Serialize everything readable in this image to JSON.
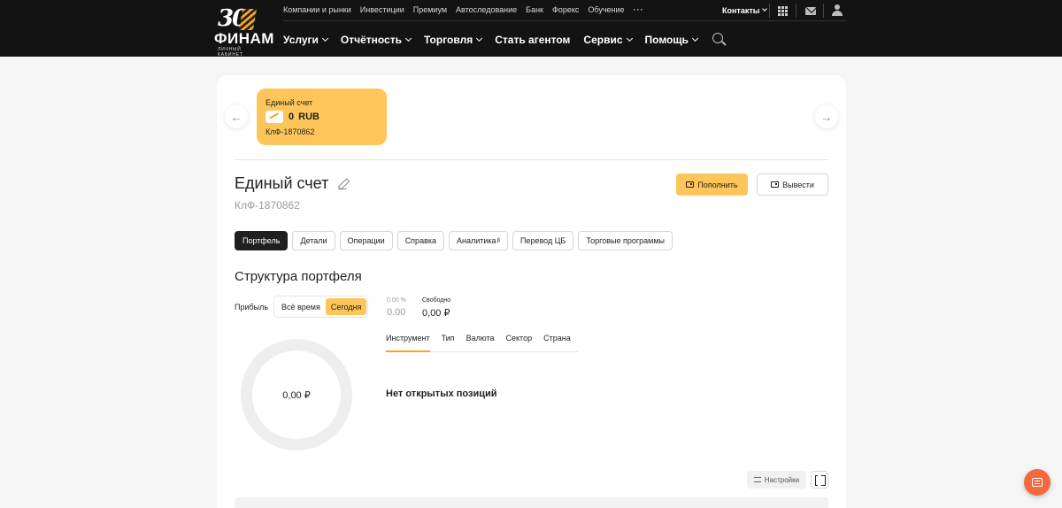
{
  "header": {
    "logo": {
      "number": "30",
      "name": "ФИНАМ",
      "subtitle": "ЛИЧНЫЙ КАБИНЕТ"
    },
    "top_links": [
      "Компании и рынки",
      "Инвестиции",
      "Премиум",
      "Автоследование",
      "Банк",
      "Форекс",
      "Обучение"
    ],
    "more_label": "···",
    "contacts_label": "Контакты",
    "main_nav": [
      "Услуги",
      "Отчётность",
      "Торговля",
      "Стать агентом",
      "Сервис",
      "Помощь"
    ]
  },
  "account_tile": {
    "title": "Единый счет",
    "amount": "0",
    "currency": "RUB",
    "code": "КлФ-1870862"
  },
  "account": {
    "title": "Единый счет",
    "code": "КлФ-1870862",
    "deposit_label": "Пополнить",
    "withdraw_label": "Вывести"
  },
  "tabs": [
    "Портфель",
    "Детали",
    "Операции",
    "Справка",
    "Аналитика",
    "Перевод ЦБ",
    "Торговые программы"
  ],
  "analytics_sup": "β",
  "portfolio": {
    "title": "Структура портфеля",
    "profit_label": "Прибыль",
    "period_options": [
      "Всё время",
      "Сегодня"
    ],
    "profit_pct": "0.00 %",
    "profit_value": "0.00",
    "free_label": "Свободно",
    "free_value": "0,00 ₽",
    "donut_value": "0,00 ₽",
    "subtabs": [
      "Инструмент",
      "Тип",
      "Валюта",
      "Сектор",
      "Страна"
    ],
    "empty_message": "Нет открытых позиций",
    "settings_label": "Настройки"
  },
  "colors": {
    "accent": "#fec65a",
    "header_bg": "#131313",
    "chat": "#f26a3d"
  }
}
